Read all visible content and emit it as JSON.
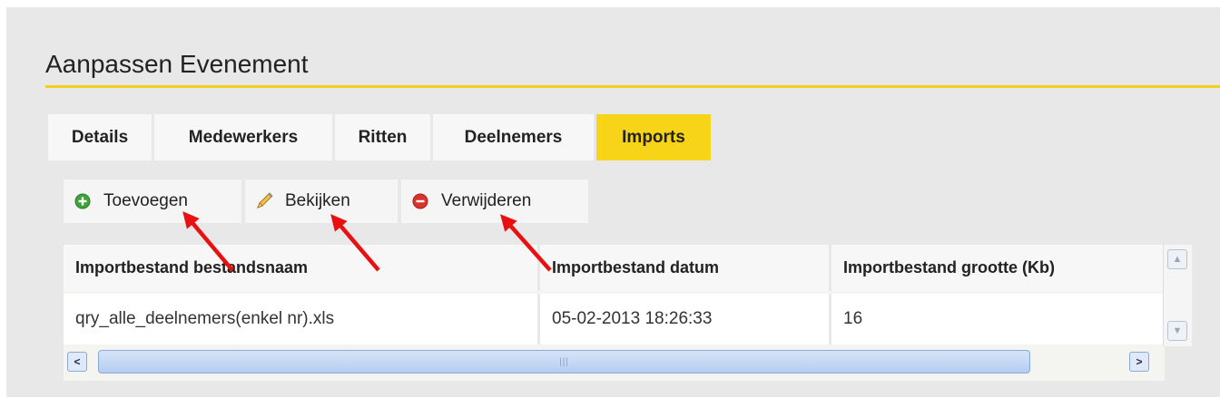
{
  "page": {
    "title": "Aanpassen Evenement"
  },
  "tabs": [
    {
      "label": "Details",
      "active": false
    },
    {
      "label": "Medewerkers",
      "active": false
    },
    {
      "label": "Ritten",
      "active": false
    },
    {
      "label": "Deelnemers",
      "active": false
    },
    {
      "label": "Imports",
      "active": true
    }
  ],
  "toolbar": {
    "add_label": "Toevoegen",
    "add_icon": "plus-circle-icon",
    "view_label": "Bekijken",
    "view_icon": "pencil-icon",
    "delete_label": "Verwijderen",
    "delete_icon": "minus-circle-icon"
  },
  "grid": {
    "columns": [
      "Importbestand bestandsnaam",
      "Importbestand datum",
      "Importbestand grootte (Kb)"
    ],
    "rows": [
      [
        "qry_alle_deelnemers(enkel nr).xls",
        "05-02-2013 18:26:33",
        "16"
      ]
    ]
  },
  "colors": {
    "accent": "#f7d417",
    "annotation_arrow": "#e81010",
    "add_icon": "#3da33a",
    "delete_icon": "#d9342b"
  }
}
